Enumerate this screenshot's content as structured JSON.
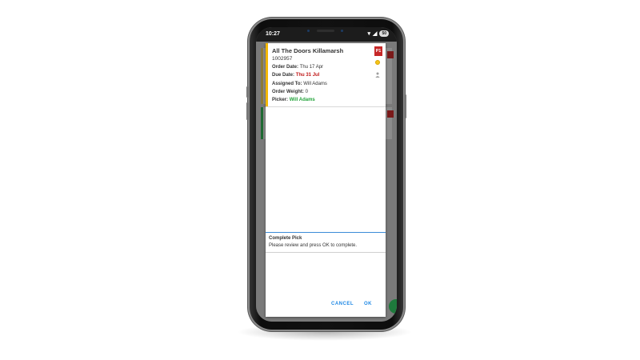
{
  "status_bar": {
    "time": "10:27",
    "signal": "▾",
    "wifi": "◢",
    "battery": "50"
  },
  "dialog": {
    "order": {
      "title": "All The Doors Killamarsh",
      "number": "1002957",
      "order_date_label": "Order Date:",
      "order_date": "Thu 17 Apr",
      "due_date_label": "Due Date:",
      "due_date": "Thu 31 Jul",
      "assigned_to_label": "Assigned To:",
      "assigned_to": "Will Adams",
      "order_weight_label": "Order Weight:",
      "order_weight": "0",
      "picker_label": "Picker:",
      "picker": "Will Adams",
      "priority": "P1"
    },
    "message": {
      "title": "Complete Pick",
      "body": "Please review and press OK to complete."
    },
    "buttons": {
      "cancel": "CANCEL",
      "ok": "OK"
    }
  },
  "colors": {
    "stripe_yellow": "#f2b705",
    "due_red": "#c01818",
    "picker_green": "#22a33a",
    "priority_red": "#c62828",
    "button_blue": "#1e88e5"
  },
  "icons": [
    "coin-icon",
    "user-icon"
  ]
}
